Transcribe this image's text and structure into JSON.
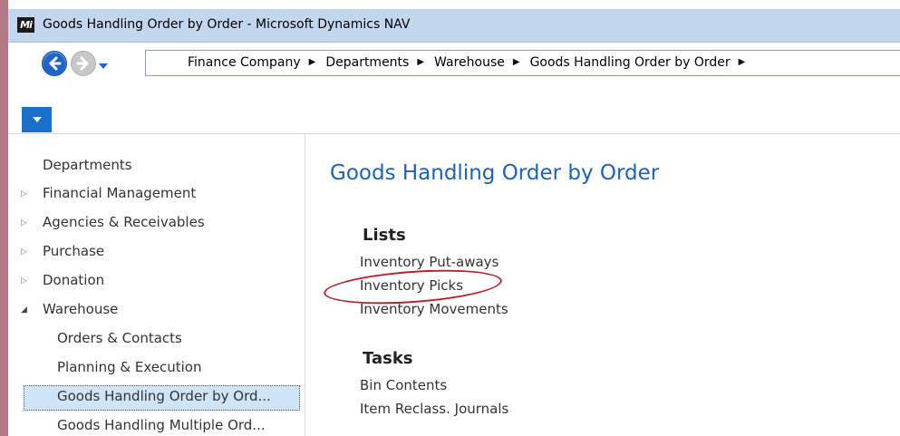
{
  "window": {
    "title": "Goods Handling Order by Order - Microsoft Dynamics NAV",
    "logo_text": "Mi"
  },
  "navigation": {
    "breadcrumbs": [
      "Finance Company",
      "Departments",
      "Warehouse",
      "Goods Handling Order by Order"
    ],
    "separator": "▶"
  },
  "sidebar": {
    "items": [
      {
        "label": "Departments"
      },
      {
        "label": "Financial Management",
        "expander": "collapsed"
      },
      {
        "label": "Agencies & Receivables",
        "expander": "collapsed"
      },
      {
        "label": "Purchase",
        "expander": "collapsed"
      },
      {
        "label": "Donation",
        "expander": "collapsed"
      },
      {
        "label": "Warehouse",
        "expander": "expanded"
      },
      {
        "label": "Orders & Contacts"
      },
      {
        "label": "Planning & Execution"
      },
      {
        "label": "Goods Handling Order by Ord...",
        "selected": true
      },
      {
        "label": "Goods Handling Multiple Ord..."
      }
    ]
  },
  "content": {
    "title": "Goods Handling Order by Order",
    "sections": [
      {
        "heading": "Lists",
        "links": [
          "Inventory Put-aways",
          "Inventory Picks",
          "Inventory Movements"
        ]
      },
      {
        "heading": "Tasks",
        "links": [
          "Bin Contents",
          "Item Reclass. Journals"
        ]
      }
    ],
    "highlighted_link": "Inventory Picks"
  },
  "colors": {
    "accent": "#1f62ad",
    "titlebar": "#c2d7ee",
    "selection": "#cfe5f7",
    "highlight_circle": "#b4232a"
  }
}
